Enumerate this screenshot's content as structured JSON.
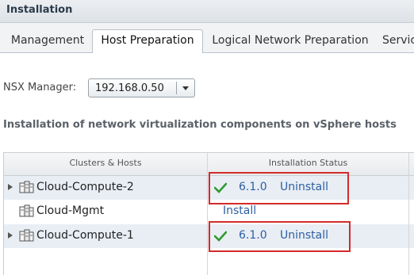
{
  "header": {
    "title": "Installation"
  },
  "tabs": [
    {
      "label": "Management",
      "active": false
    },
    {
      "label": "Host Preparation",
      "active": true
    },
    {
      "label": "Logical Network Preparation",
      "active": false
    },
    {
      "label": "Servic",
      "active": false
    }
  ],
  "nsx_manager": {
    "label": "NSX Manager:",
    "value": "192.168.0.50"
  },
  "description": "Installation of network virtualization components on vSphere hosts",
  "grid": {
    "columns": [
      "Clusters & Hosts",
      "Installation Status"
    ],
    "rows": [
      {
        "name": "Cloud-Compute-2",
        "expandable": true,
        "version": "6.1.0",
        "action": "Uninstall",
        "installed": true,
        "highlighted": true
      },
      {
        "name": "Cloud-Mgmt",
        "expandable": false,
        "version": "",
        "action": "Install",
        "installed": false,
        "highlighted": false
      },
      {
        "name": "Cloud-Compute-1",
        "expandable": true,
        "version": "6.1.0",
        "action": "Uninstall",
        "installed": true,
        "highlighted": true
      }
    ]
  },
  "icons": {
    "cluster": "cluster-icon",
    "check": "checkmark-icon",
    "expand": "expand-arrow-icon",
    "dropdown": "chevron-down-icon"
  },
  "colors": {
    "highlight": "#d42a2a",
    "check": "#2e9b2e",
    "link": "#2d5fa0"
  }
}
